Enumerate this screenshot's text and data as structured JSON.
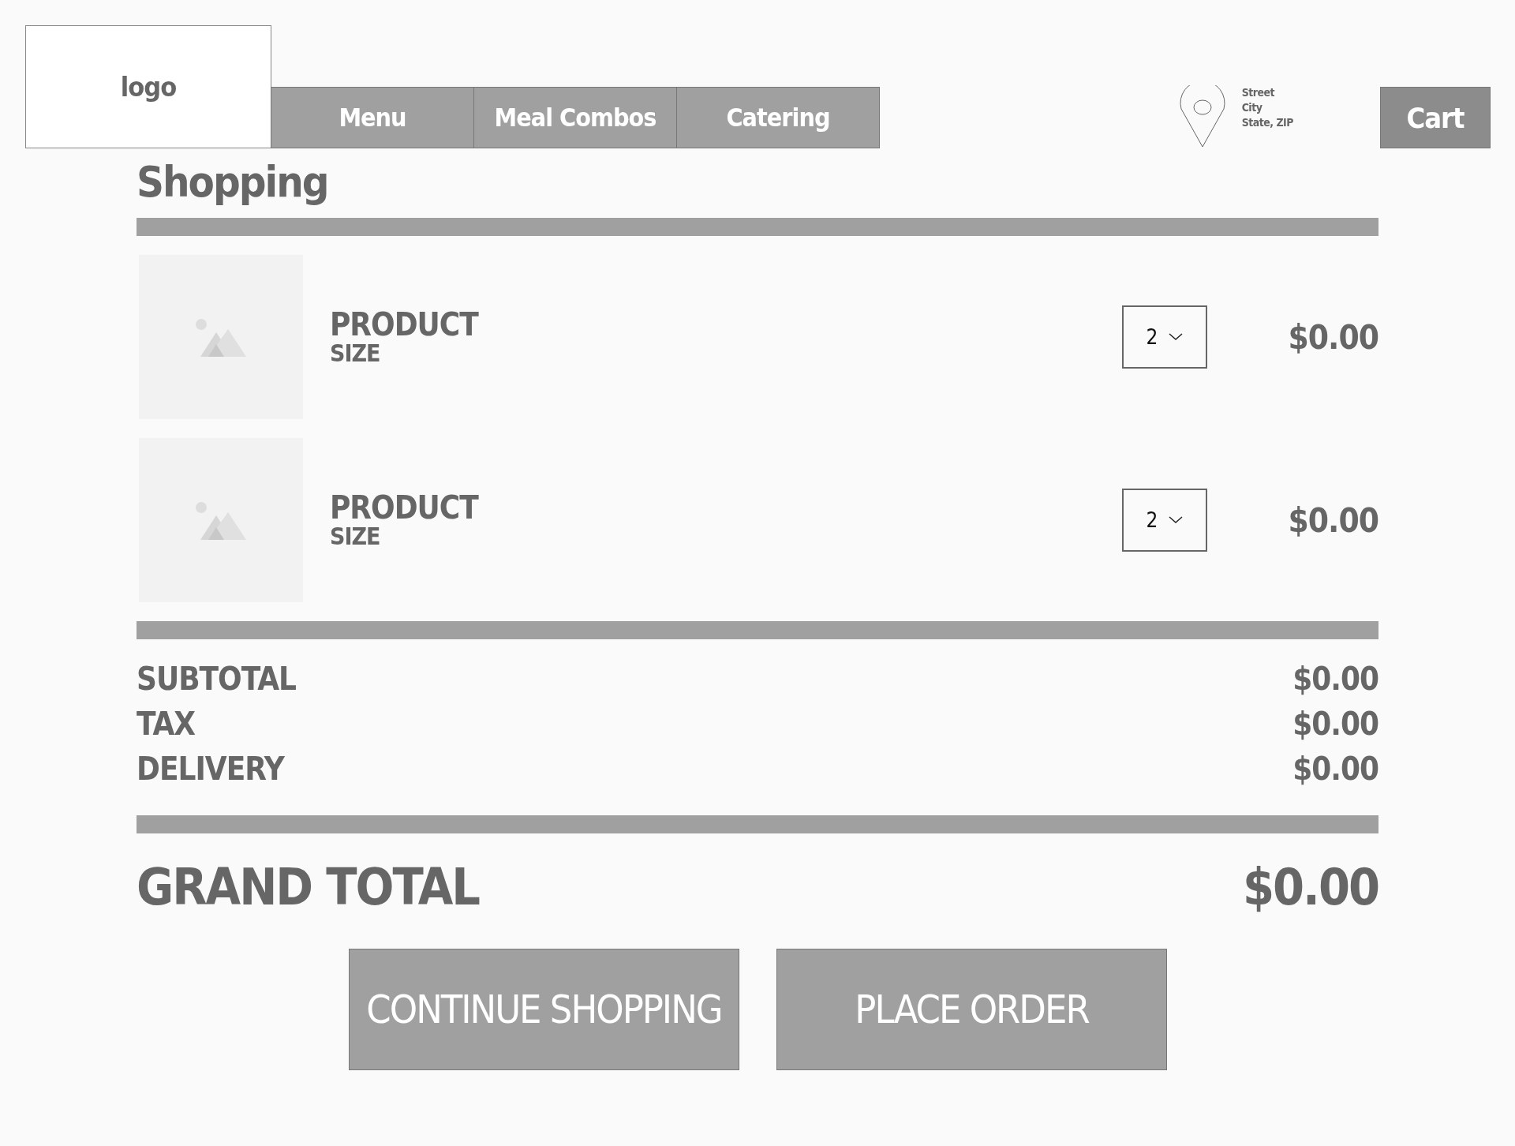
{
  "header": {
    "logo": "logo",
    "nav": [
      {
        "label": "Menu"
      },
      {
        "label": "Meal Combos"
      },
      {
        "label": "Catering"
      }
    ],
    "address": [
      "Street",
      "City",
      "State, ZIP"
    ],
    "cart": "Cart"
  },
  "title": "Shopping",
  "items": [
    {
      "name": "PRODUCT",
      "size": "SIZE",
      "quantity": "2",
      "price": "$0.00"
    },
    {
      "name": "PRODUCT",
      "size": "SIZE",
      "quantity": "2",
      "price": "$0.00"
    }
  ],
  "summary": [
    {
      "label": "SUBTOTAL",
      "value": "$0.00"
    },
    {
      "label": "TAX",
      "value": "$0.00"
    },
    {
      "label": "DELIVERY",
      "value": "$0.00"
    }
  ],
  "grand_total": {
    "label": "GRAND TOTAL",
    "value": "$0.00"
  },
  "buttons": [
    "CONTINUE SHOPPING",
    "PLACE ORDER"
  ]
}
